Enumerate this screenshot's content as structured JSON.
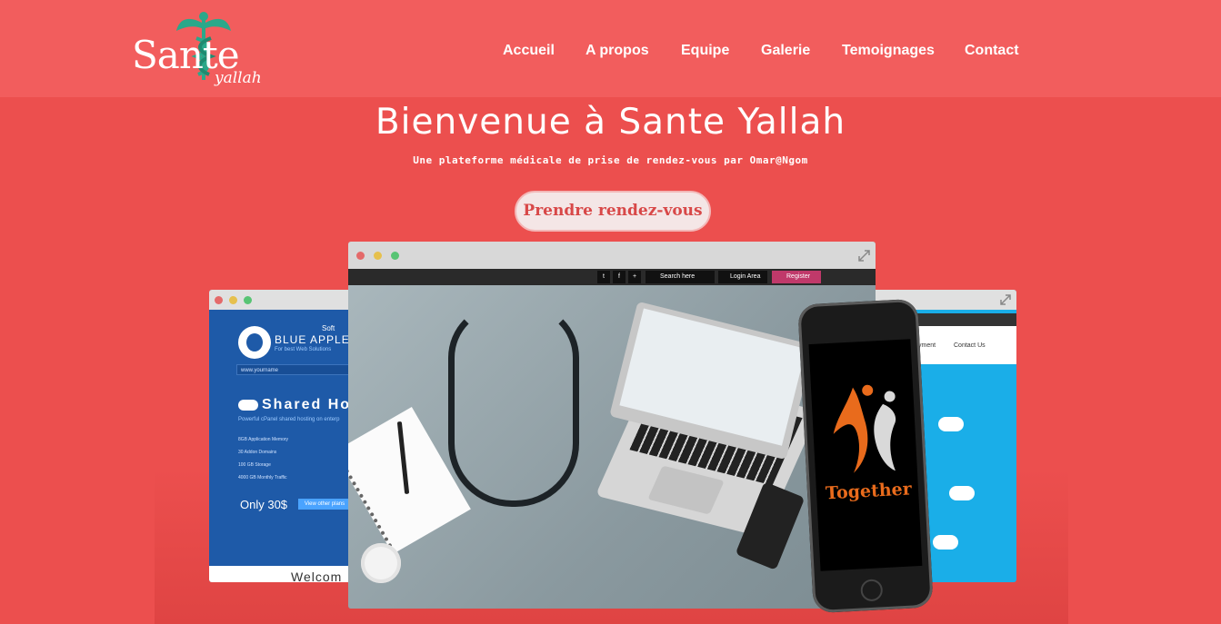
{
  "brand": {
    "name_main": "Sante",
    "name_sub": "yallah"
  },
  "nav": {
    "items": [
      "Accueil",
      "A propos",
      "Equipe",
      "Galerie",
      "Temoignages",
      "Contact"
    ]
  },
  "hero": {
    "title": "Bienvenue à Sante Yallah",
    "subtitle": "Une plateforme médicale de prise de rendez-vous par Omar@Ngom",
    "cta": "Prendre rendez-vous"
  },
  "mockup_center": {
    "search_placeholder": "Search here",
    "login": "Login Area",
    "register": "Register"
  },
  "mockup_left": {
    "brand": "BLUE APPLE",
    "brand_soft": "Soft",
    "tagline": "For best Web Solutions",
    "input": "www.yourname",
    "heading": "Shared Ho",
    "desc": "Powerful cPanel shared hosting on enterp",
    "features": [
      "8GB Application Memory",
      "30 Addon Domains",
      "100 GB Storage",
      "4000 GB Monthly Traffic"
    ],
    "price": "Only 30$",
    "plans_btn": "View other plans",
    "welcome": "Welcom"
  },
  "mockup_right": {
    "menu": [
      "yment",
      "Contact Us"
    ]
  },
  "phone": {
    "app_name": "Together"
  },
  "colors": {
    "background": "#ec4f4e",
    "header": "#f25d5d",
    "logo_accent": "#2aa88a",
    "cta_text": "#d84848"
  }
}
